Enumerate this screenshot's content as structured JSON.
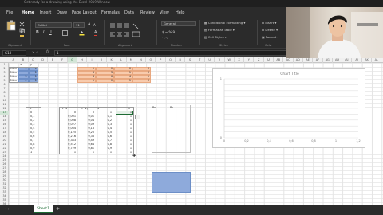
{
  "window": {
    "title": "Get ready for a drawing using the Excel 2019 Window"
  },
  "menu": [
    "File",
    "Home",
    "Insert",
    "Draw",
    "Page Layout",
    "Formulas",
    "Data",
    "Review",
    "View",
    "Help"
  ],
  "ribbon": {
    "font_name": "Calibri",
    "font_size": "11",
    "number_format": "General",
    "conditional_formatting": "Conditional Formatting",
    "format_as_table": "Format as Table",
    "cell_styles": "Cell Styles",
    "insert": "Insert",
    "delete": "Delete",
    "format": "Format",
    "groups": [
      "Clipboard",
      "Font",
      "Alignment",
      "Number",
      "Styles",
      "Cells"
    ]
  },
  "formula_bar": {
    "name_box": "G13",
    "fx": "fx",
    "value": "1"
  },
  "columns": [
    "A",
    "B",
    "C",
    "D",
    "E",
    "F",
    "G",
    "H",
    "I",
    "J",
    "K",
    "L",
    "M",
    "N",
    "O",
    "P",
    "Q",
    "R",
    "S",
    "T",
    "U",
    "V",
    "W",
    "X",
    "Y",
    "Z",
    "AA",
    "AB",
    "AC",
    "AD",
    "AE",
    "AF",
    "AG",
    "AH",
    "AI",
    "AJ",
    "AK",
    "AL"
  ],
  "top_table": {
    "header": [
      "x",
      "y"
    ],
    "rows": [
      {
        "label": "Điểm 1",
        "x": "1",
        "y": "1"
      },
      {
        "label": "Điểm 2",
        "x": "",
        "y": "1"
      },
      {
        "label": "Điểm 3",
        "x": "3",
        "y": "1"
      },
      {
        "label": "Điểm 4",
        "x": "4",
        "y": "1"
      }
    ]
  },
  "orange_matrix": [
    [
      "1",
      "0",
      "0",
      "0"
    ],
    [
      "3",
      "3",
      "1",
      "0"
    ],
    [
      "4",
      "6",
      "4",
      "1"
    ],
    [
      "1",
      "0",
      "1",
      "0"
    ]
  ],
  "lower_table": {
    "headers": [
      "t",
      "t^3",
      "(t^2)",
      "1"
    ],
    "t_values": [
      "0",
      "0,1",
      "0,2",
      "0,3",
      "0,4",
      "0,5",
      "0,6",
      "0,7",
      "0,8",
      "0,9",
      "1"
    ],
    "col_e": [
      "0",
      "0,001",
      "0,008",
      "0,027",
      "0,064",
      "0,125",
      "0,216",
      "0,343",
      "0,512",
      "0,729",
      "1"
    ],
    "col_f": [
      "0",
      "0,01",
      "0,04",
      "0,09",
      "0,16",
      "0,25",
      "0,36",
      "0,49",
      "0,64",
      "0,81",
      "1"
    ],
    "col_g": [
      "1",
      "0,1",
      "0,2",
      "0,3",
      "0,4",
      "0,5",
      "0,6",
      "0,7",
      "0,8",
      "0,9",
      "1"
    ],
    "col_h": [
      "1",
      "1",
      "1",
      "1",
      "1",
      "1",
      "1",
      "1",
      "1",
      "1",
      "1"
    ]
  },
  "px_py": [
    "Px",
    "Py"
  ],
  "chart": {
    "title": "Chart Title",
    "y_ticks": [
      "1",
      "",
      "",
      "",
      "",
      "",
      "",
      "",
      "",
      "",
      "0"
    ],
    "x_ticks": [
      "0",
      "0,2",
      "0,4",
      "0,6",
      "0,8",
      "1",
      "1,2"
    ]
  },
  "sheet_tab": "Sheet1",
  "add_sheet": "+"
}
